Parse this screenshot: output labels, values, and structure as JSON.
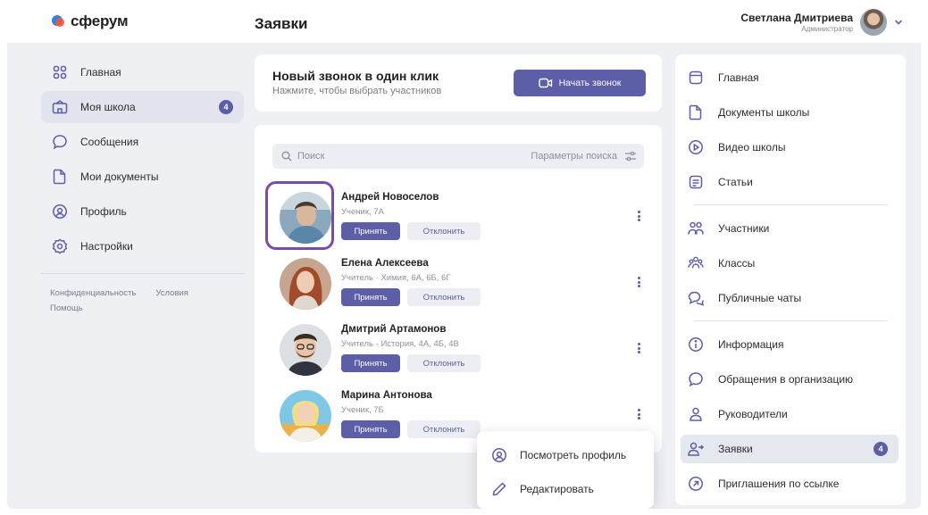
{
  "app": {
    "logo_text": "сферум",
    "page_title": "Заявки"
  },
  "user": {
    "name": "Светлана Дмитриева",
    "role": "Администратор"
  },
  "leftnav": {
    "items": [
      {
        "label": "Главная",
        "icon": "grid-icon"
      },
      {
        "label": "Моя школа",
        "icon": "school-icon",
        "badge": "4"
      },
      {
        "label": "Сообщения",
        "icon": "chat-icon"
      },
      {
        "label": "Мои документы",
        "icon": "document-icon"
      },
      {
        "label": "Профиль",
        "icon": "profile-icon"
      },
      {
        "label": "Настройки",
        "icon": "gear-icon"
      }
    ],
    "footer": {
      "privacy": "Конфиденциальность",
      "terms": "Условия",
      "help": "Помощь"
    }
  },
  "call": {
    "title": "Новый звонок в один клик",
    "subtitle": "Нажмите, чтобы выбрать участников",
    "button": "Начать звонок"
  },
  "search": {
    "placeholder": "Поиск",
    "params": "Параметры поиска"
  },
  "requests": [
    {
      "name": "Андрей Новоселов",
      "info": "Ученик, 7А",
      "accept": "Принять",
      "decline": "Отклонить"
    },
    {
      "name": "Елена Алексеева",
      "info": "Учитель · Химия, 6А, 6Б, 6Г",
      "accept": "Принять",
      "decline": "Отклонить"
    },
    {
      "name": "Дмитрий Артамонов",
      "info": "Учитель · История, 4А, 4Б, 4В",
      "accept": "Принять",
      "decline": "Отклонить"
    },
    {
      "name": "Марина Антонова",
      "info": "Ученик, 7Б",
      "accept": "Принять",
      "decline": "Отклонить"
    }
  ],
  "popup": {
    "view_profile": "Посмотреть профиль",
    "edit": "Редактировать"
  },
  "right": {
    "items": [
      {
        "label": "Главная",
        "icon": "square-icon"
      },
      {
        "label": "Документы школы",
        "icon": "document-icon"
      },
      {
        "label": "Видео школы",
        "icon": "play-icon"
      },
      {
        "label": "Статьи",
        "icon": "article-icon"
      },
      {
        "label": "Участники",
        "icon": "users-icon"
      },
      {
        "label": "Классы",
        "icon": "classes-icon"
      },
      {
        "label": "Публичные чаты",
        "icon": "chats-icon"
      },
      {
        "label": "Информация",
        "icon": "info-icon"
      },
      {
        "label": "Обращения в организацию",
        "icon": "chat-icon"
      },
      {
        "label": "Руководители",
        "icon": "person-icon"
      },
      {
        "label": "Заявки",
        "icon": "user-add-icon",
        "badge": "4"
      },
      {
        "label": "Приглашения по ссылке",
        "icon": "link-icon"
      }
    ]
  },
  "colors": {
    "accent": "#5c5ea8",
    "highlight": "#7d4aa8",
    "background": "#eef0f4"
  }
}
